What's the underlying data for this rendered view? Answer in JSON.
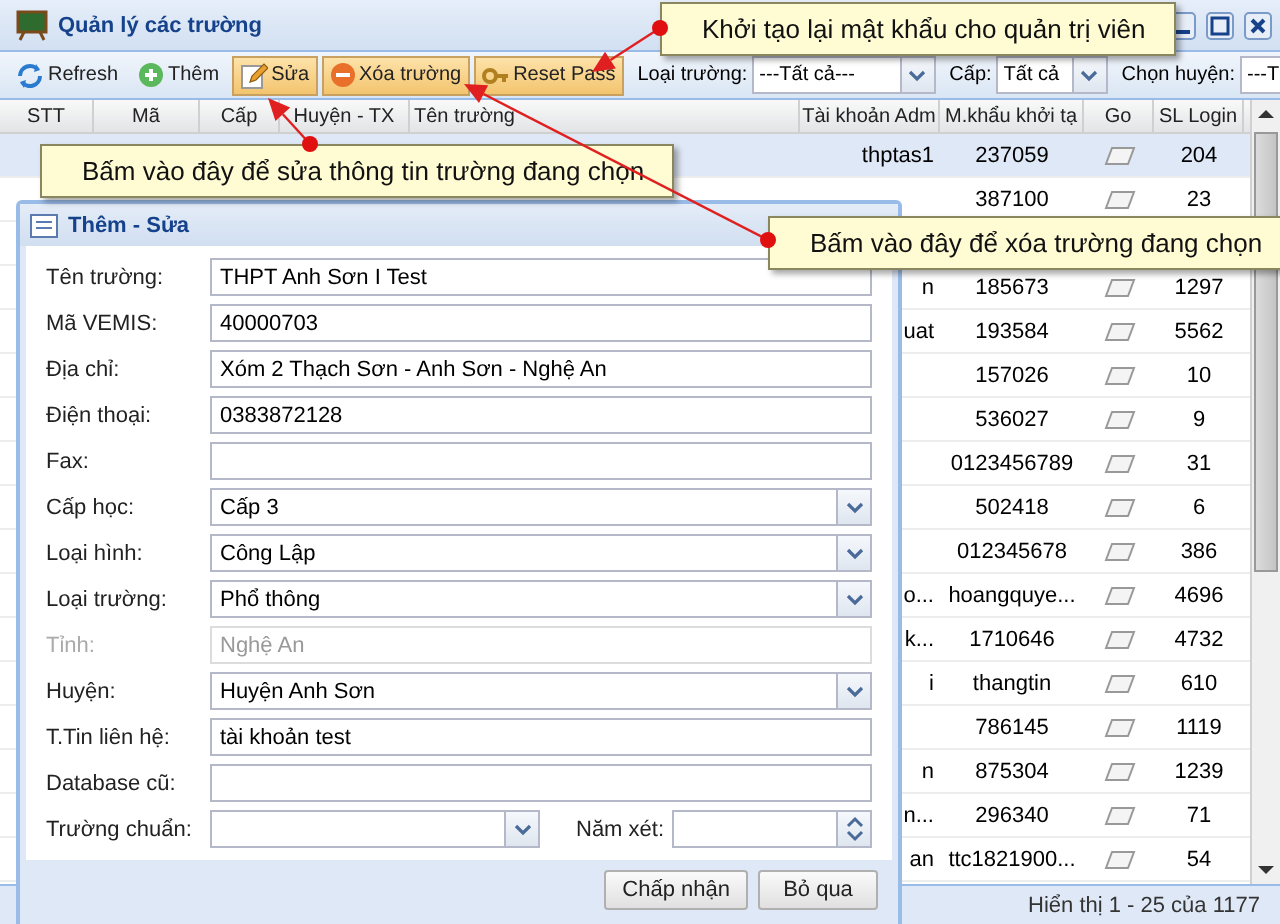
{
  "window": {
    "title": "Quản lý các trường"
  },
  "toolbar": {
    "buttons": [
      {
        "kind": "refresh",
        "label": "Refresh",
        "highlighted": false
      },
      {
        "kind": "add",
        "label": "Thêm",
        "highlighted": false
      },
      {
        "kind": "edit",
        "label": "Sửa",
        "highlighted": true
      },
      {
        "kind": "delete",
        "label": "Xóa trường",
        "highlighted": true
      },
      {
        "kind": "key",
        "label": "Reset Pass",
        "highlighted": true
      }
    ],
    "filters": [
      {
        "label": "Loại trường:",
        "value": "---Tất cả---"
      },
      {
        "label": "Cấp:",
        "value": "Tất cả"
      },
      {
        "label": "Chọn huyện:",
        "value": "---T"
      }
    ]
  },
  "table": {
    "columns": [
      "STT",
      "Mã",
      "Cấp",
      "Huyện - TX",
      "Tên trường",
      "Tài khoản Adm",
      "M.khẩu khởi tạ",
      "Go",
      "SL Login"
    ],
    "rows": [
      {
        "account": "thptas1",
        "password": "237059",
        "sl_login": "204",
        "selected": true
      },
      {
        "password": "387100",
        "sl_login": "23",
        "selected": false
      },
      {
        "selected": false
      },
      {
        "account": "n",
        "password": "185673",
        "sl_login": "1297",
        "selected": false
      },
      {
        "account": "uat",
        "password": "193584",
        "sl_login": "5562",
        "selected": false
      },
      {
        "password": "157026",
        "sl_login": "10",
        "selected": false
      },
      {
        "password": "536027",
        "sl_login": "9",
        "selected": false
      },
      {
        "password": "0123456789",
        "sl_login": "31",
        "selected": false
      },
      {
        "password": "502418",
        "sl_login": "6",
        "selected": false
      },
      {
        "password": "012345678",
        "sl_login": "386",
        "selected": false
      },
      {
        "account": "o...",
        "password": "hoangquye...",
        "sl_login": "4696",
        "selected": false
      },
      {
        "account": "k...",
        "password": "1710646",
        "sl_login": "4732",
        "selected": false
      },
      {
        "account": "i",
        "password": "thangtin",
        "sl_login": "610",
        "selected": false
      },
      {
        "password": "786145",
        "sl_login": "1119",
        "selected": false
      },
      {
        "account": "n",
        "password": "875304",
        "sl_login": "1239",
        "selected": false
      },
      {
        "account": "n...",
        "password": "296340",
        "sl_login": "71",
        "selected": false
      },
      {
        "account": "an",
        "password": "ttc1821900...",
        "sl_login": "54",
        "selected": false
      }
    ]
  },
  "status_bar": "Hiển thị 1 - 25 của 1177",
  "dialog": {
    "title": "Thêm - Sửa",
    "fields": [
      {
        "kind": "text",
        "label": "Tên trường:",
        "value": "THPT Anh Sơn I Test",
        "disabled": false
      },
      {
        "kind": "text",
        "label": "Mã VEMIS:",
        "value": "40000703",
        "disabled": false
      },
      {
        "kind": "text",
        "label": "Địa chỉ:",
        "value": "Xóm 2 Thạch Sơn - Anh Sơn - Nghệ An",
        "disabled": false
      },
      {
        "kind": "text",
        "label": "Điện thoại:",
        "value": "0383872128",
        "disabled": false
      },
      {
        "kind": "text",
        "label": "Fax:",
        "disabled": false
      },
      {
        "kind": "select",
        "label": "Cấp học:",
        "value": "Cấp 3",
        "disabled": false
      },
      {
        "kind": "select",
        "label": "Loại hình:",
        "value": "Công Lập",
        "disabled": false
      },
      {
        "kind": "select",
        "label": "Loại trường:",
        "value": "Phổ thông",
        "disabled": false
      },
      {
        "kind": "text",
        "label": "Tỉnh:",
        "value": "Nghệ An",
        "disabled": true
      },
      {
        "kind": "select",
        "label": "Huyện:",
        "value": "Huyện Anh Sơn",
        "disabled": false
      },
      {
        "kind": "text",
        "label": "T.Tin liên hệ:",
        "value": "tài khoản test",
        "disabled": false
      },
      {
        "kind": "text",
        "label": "Database cũ:",
        "disabled": false
      },
      {
        "kind": "select_spinner",
        "label": "Trường chuẩn:",
        "second_label": "Năm xét:",
        "disabled": false
      }
    ],
    "buttons": [
      "Chấp nhận",
      "Bỏ qua"
    ]
  },
  "callouts": [
    "Khởi tạo lại mật khẩu cho quản trị viên",
    "Bấm vào đây để sửa thông tin trường đang chọn",
    "Bấm vào đây để xóa trường đang chọn"
  ]
}
